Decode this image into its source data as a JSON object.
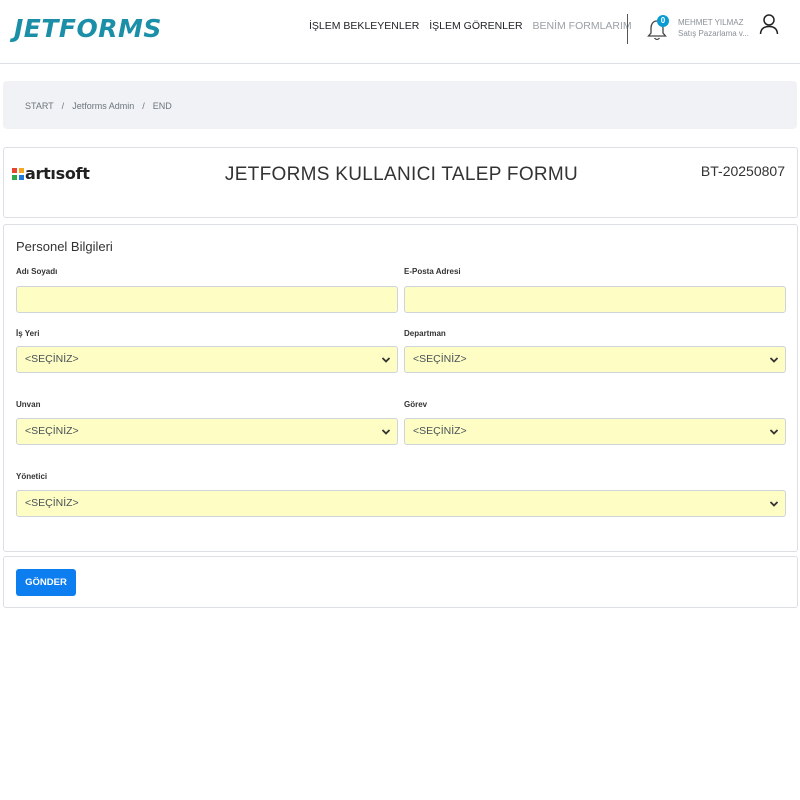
{
  "app": {
    "logo": "JETFORMS"
  },
  "nav": {
    "items": [
      {
        "label": "İŞLEM BEKLEYENLER"
      },
      {
        "label": "İŞLEM GÖRENLER"
      },
      {
        "label": "BENİM FORMLARIM"
      }
    ]
  },
  "notifications": {
    "count": "0"
  },
  "user": {
    "name": "MEHMET YILMAZ",
    "role": "Satış Pazarlama v..."
  },
  "breadcrumb": {
    "items": [
      "START",
      "Jetforms Admin",
      "END"
    ],
    "separator": "/"
  },
  "form_header": {
    "brand": "artısoft",
    "title": "JETFORMS KULLANICI TALEP FORMU",
    "code": "BT-20250807"
  },
  "form": {
    "section_title": "Personel Bilgileri",
    "fields": {
      "name": {
        "label": "Adı Soyadı",
        "value": ""
      },
      "email": {
        "label": "E-Posta Adresi",
        "value": ""
      },
      "workplace": {
        "label": "İş Yeri",
        "value": "<SEÇİNİZ>"
      },
      "department": {
        "label": "Departman",
        "value": "<SEÇİNİZ>"
      },
      "title": {
        "label": "Unvan",
        "value": "<SEÇİNİZ>"
      },
      "duty": {
        "label": "Görev",
        "value": "<SEÇİNİZ>"
      },
      "manager": {
        "label": "Yönetici",
        "value": "<SEÇİNİZ>"
      }
    },
    "submit_label": "GÖNDER"
  },
  "colors": {
    "brand": "#1b8fa8",
    "field_bg": "#fdfdc4",
    "primary_button": "#0d7ef0",
    "badge": "#0a9bd3"
  }
}
